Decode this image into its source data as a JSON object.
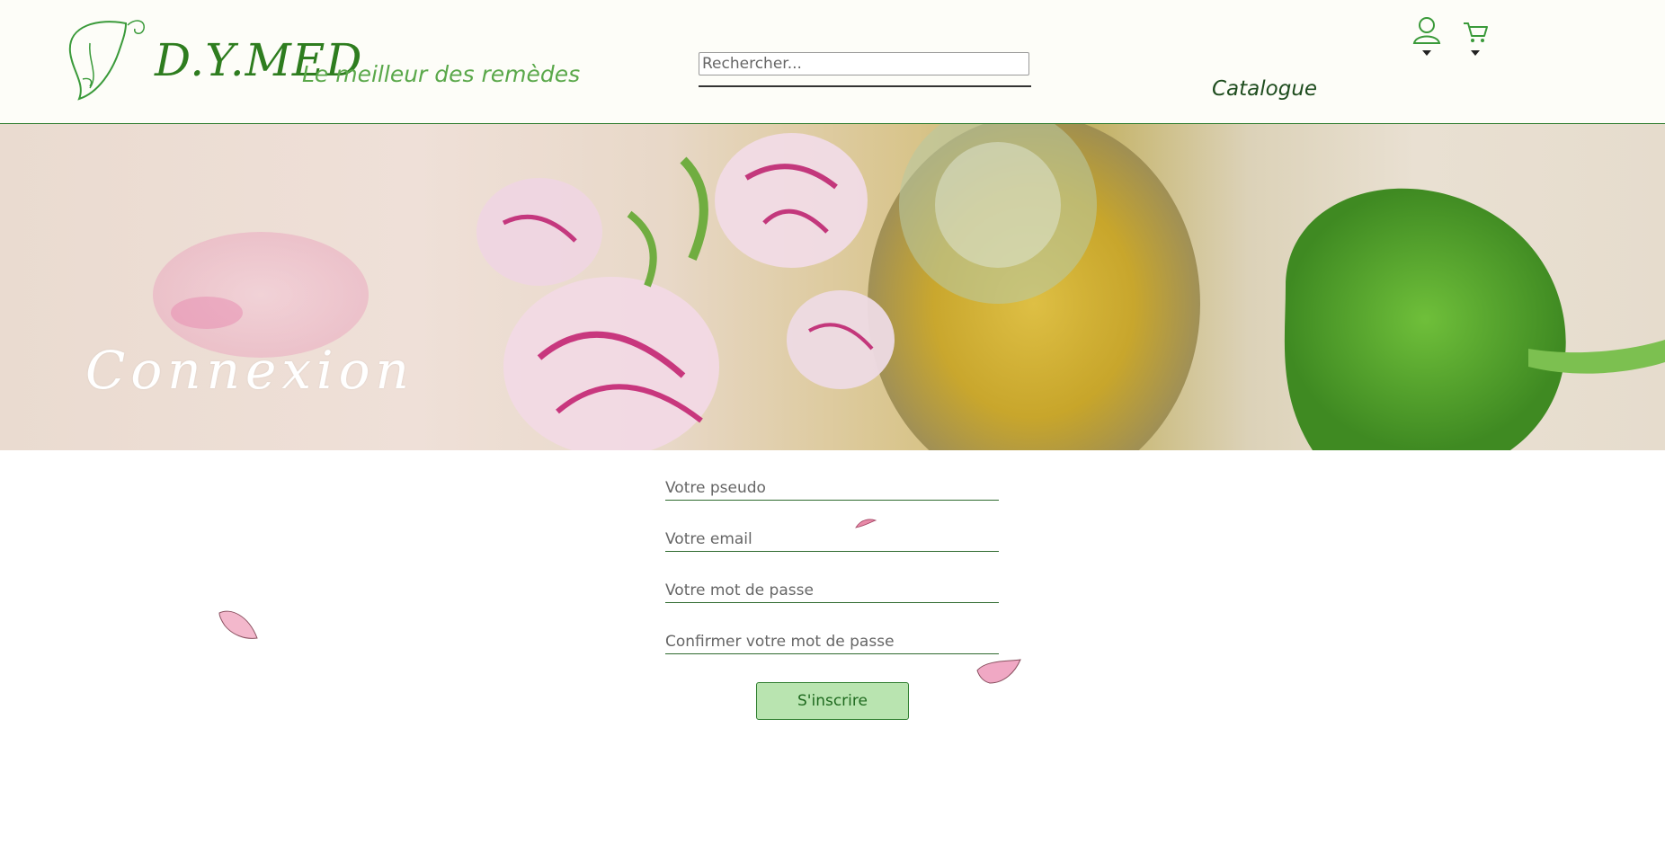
{
  "header": {
    "brand_name": "D.Y.MED",
    "tagline": "Le meilleur des remèdes",
    "search_placeholder": "Rechercher...",
    "nav_catalogue": "Catalogue",
    "icons": [
      "user-icon",
      "cart-icon"
    ]
  },
  "banner": {
    "title": "Connexion"
  },
  "form": {
    "pseudo_placeholder": "Votre pseudo",
    "email_placeholder": "Votre email",
    "password_placeholder": "Votre mot de passe",
    "confirm_placeholder": "Confirmer votre mot de passe",
    "submit_label": "S'inscrire"
  },
  "colors": {
    "brand_green": "#2e7d1f",
    "accent_green": "#5aa84a",
    "button_bg": "#b9e4b0",
    "header_border": "#2f7d2f"
  }
}
